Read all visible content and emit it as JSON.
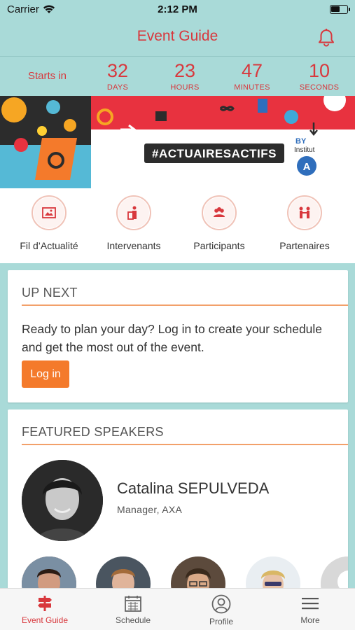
{
  "status_bar": {
    "carrier": "Carrier",
    "time": "2:12 PM"
  },
  "header": {
    "title": "Event Guide",
    "bell_icon": "bell-icon"
  },
  "countdown": {
    "label": "Starts in",
    "units": [
      {
        "value": "32",
        "caption": "DAYS"
      },
      {
        "value": "23",
        "caption": "HOURS"
      },
      {
        "value": "47",
        "caption": "MINUTES"
      },
      {
        "value": "10",
        "caption": "SECONDS"
      }
    ]
  },
  "banner": {
    "hashtag": "#ACTUAIRESACTIFS",
    "by": "BY",
    "org": "Institut"
  },
  "quick_links": [
    {
      "label": "Fil d’Actualité",
      "icon": "news-feed-icon"
    },
    {
      "label": "Intervenants",
      "icon": "speaker-podium-icon"
    },
    {
      "label": "Participants",
      "icon": "people-icon"
    },
    {
      "label": "Partenaires",
      "icon": "partners-icon"
    }
  ],
  "up_next": {
    "title": "UP NEXT",
    "text": "Ready to plan your day? Log in to create your schedule and get the most out of the event.",
    "login_label": "Log in"
  },
  "featured_speakers": {
    "title": "FEATURED SPEAKERS",
    "main": {
      "name": "Catalina SEPULVEDA",
      "role": "Manager, AXA"
    }
  },
  "tabbar": {
    "items": [
      {
        "label": "Event Guide",
        "icon": "signpost-icon",
        "active": true
      },
      {
        "label": "Schedule",
        "icon": "calendar-icon",
        "active": false
      },
      {
        "label": "Profile",
        "icon": "profile-icon",
        "active": false
      },
      {
        "label": "More",
        "icon": "menu-icon",
        "active": false
      }
    ]
  },
  "colors": {
    "accent": "#d8383d",
    "teal": "#a9dad8",
    "button": "#f47a2b",
    "rule": "#f2a06a"
  }
}
